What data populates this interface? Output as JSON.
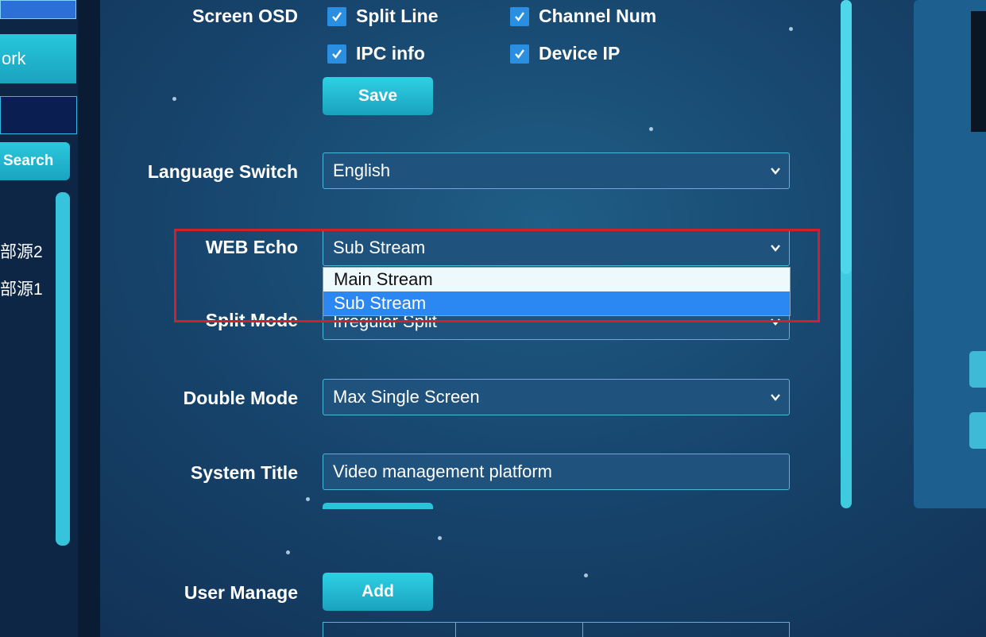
{
  "sidebar": {
    "work_label": "ork",
    "search_label": "Search",
    "items": [
      "部源2",
      "部源1"
    ]
  },
  "settings": {
    "screen_osd_label": "Screen OSD",
    "checkboxes": [
      {
        "label": "Split Line",
        "checked": true
      },
      {
        "label": "Channel Num",
        "checked": true
      },
      {
        "label": "IPC info",
        "checked": true
      },
      {
        "label": "Device IP",
        "checked": true
      }
    ],
    "save_label": "Save",
    "language_label": "Language Switch",
    "language_value": "English",
    "web_echo_label": "WEB Echo",
    "web_echo_value": "Sub Stream",
    "web_echo_options": [
      "Main Stream",
      "Sub Stream"
    ],
    "split_mode_label": "Split Mode",
    "split_mode_value": "Irregular Split",
    "double_mode_label": "Double Mode",
    "double_mode_value": "Max Single Screen",
    "system_title_label": "System Title",
    "system_title_value": "Video management platform",
    "user_manage_label": "User Manage",
    "add_label": "Add"
  },
  "colors": {
    "accent": "#2ed0e4",
    "highlight": "#d11f2c",
    "selected_option": "#2b87f2"
  }
}
